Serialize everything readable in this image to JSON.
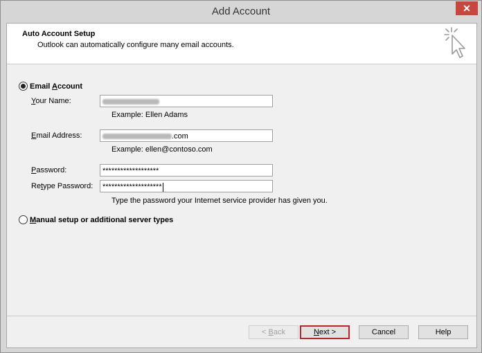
{
  "window": {
    "title": "Add Account",
    "close_glyph": "✕"
  },
  "header": {
    "title": "Auto Account Setup",
    "subtitle": "Outlook can automatically configure many email accounts."
  },
  "email_option": {
    "pre": "Email ",
    "accel": "A",
    "post": "ccount",
    "selected": true
  },
  "fields": {
    "name": {
      "label_accel": "Y",
      "label_rest": "our Name:",
      "hint": "Example: Ellen Adams"
    },
    "email": {
      "label_accel": "E",
      "label_rest": "mail Address:",
      "value_suffix": ".com",
      "hint": "Example: ellen@contoso.com"
    },
    "password": {
      "label_accel": "P",
      "label_rest": "assword:",
      "value": "*******************"
    },
    "retype": {
      "label_pre": "Re",
      "label_accel": "t",
      "label_rest": "ype Password:",
      "value": "********************",
      "hint": "Type the password your Internet service provider has given you."
    }
  },
  "manual_option": {
    "accel": "M",
    "rest": "anual setup or additional server types",
    "selected": false
  },
  "buttons": {
    "back": {
      "pre": "< ",
      "accel": "B",
      "rest": "ack"
    },
    "next": {
      "accel": "N",
      "rest": "ext >"
    },
    "cancel": "Cancel",
    "help": "Help"
  },
  "icons": {
    "header": "cursor-sparkle-icon"
  }
}
